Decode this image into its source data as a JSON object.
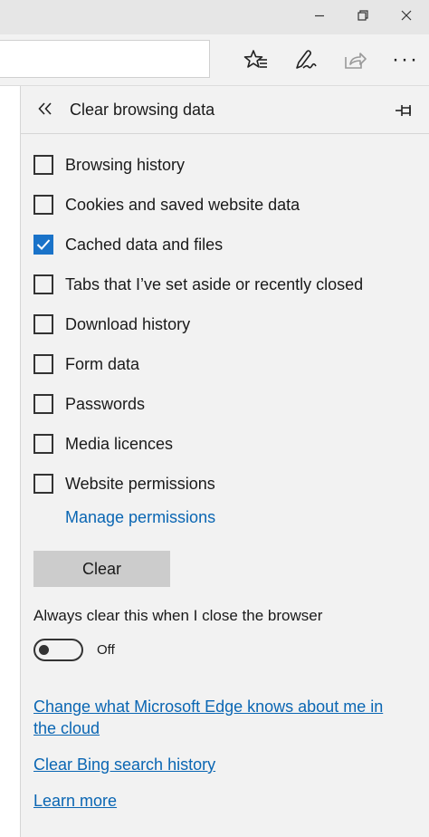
{
  "window": {
    "minimize_icon": "minimize-icon",
    "restore_icon": "restore-icon",
    "close_icon": "close-icon"
  },
  "toolbar": {
    "favorites_icon": "favorites-list-icon",
    "notes_icon": "web-note-pen-icon",
    "share_icon": "share-icon",
    "more_label": "···"
  },
  "panel": {
    "title": "Clear browsing data",
    "options": [
      {
        "label": "Browsing history",
        "checked": false
      },
      {
        "label": "Cookies and saved website data",
        "checked": false
      },
      {
        "label": "Cached data and files",
        "checked": true
      },
      {
        "label": "Tabs that I’ve set aside or recently closed",
        "checked": false
      },
      {
        "label": "Download history",
        "checked": false
      },
      {
        "label": "Form data",
        "checked": false
      },
      {
        "label": "Passwords",
        "checked": false
      },
      {
        "label": "Media licences",
        "checked": false
      },
      {
        "label": "Website permissions",
        "checked": false
      }
    ],
    "manage_permissions": "Manage permissions",
    "clear_button": "Clear",
    "always_clear_label": "Always clear this when I close the browser",
    "toggle_state": "Off",
    "toggle_on": false,
    "links": {
      "cloud_line1": "Change what Microsoft Edge knows about me in",
      "cloud_line2": "the cloud",
      "bing": "Clear Bing search history",
      "learn_more": "Learn more"
    }
  },
  "colors": {
    "accent": "#1a73c9",
    "link": "#0a66b3",
    "panel_bg": "#f2f2f2",
    "button_bg": "#cccccc"
  }
}
